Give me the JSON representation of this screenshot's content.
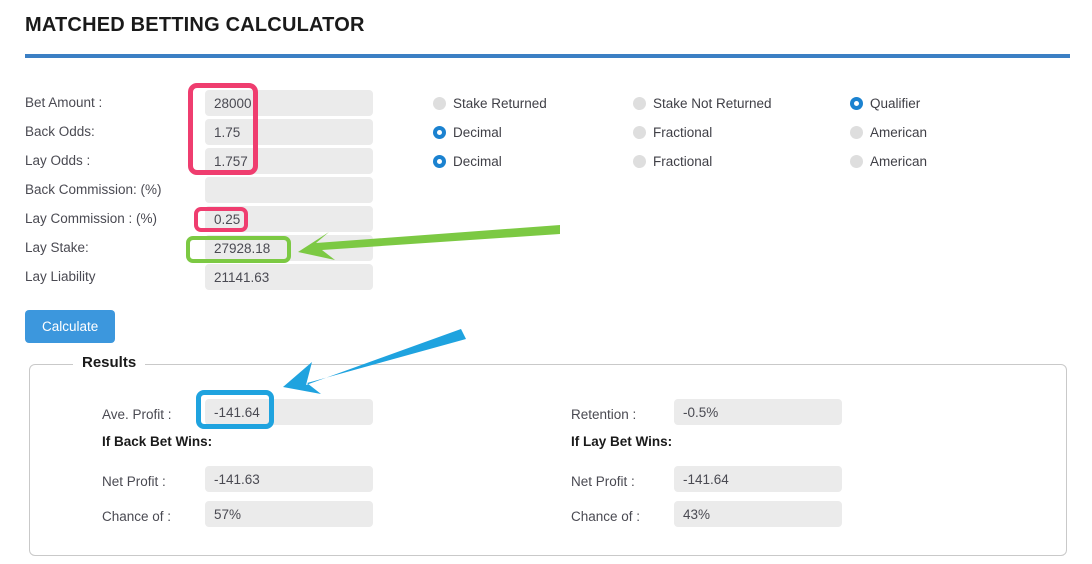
{
  "header": {
    "title": "MATCHED BETTING CALCULATOR"
  },
  "form": {
    "fields": [
      {
        "label": "Bet Amount :",
        "value": "28000",
        "name": "bet-amount"
      },
      {
        "label": "Back Odds:",
        "value": "1.75",
        "name": "back-odds"
      },
      {
        "label": "Lay Odds :",
        "value": "1.757",
        "name": "lay-odds"
      },
      {
        "label": "Back Commission: (%)",
        "value": "",
        "name": "back-commission"
      },
      {
        "label": "Lay Commission : (%)",
        "value": "0.25",
        "name": "lay-commission"
      },
      {
        "label": "Lay Stake:",
        "value": "27928.18",
        "name": "lay-stake"
      },
      {
        "label": "Lay Liability",
        "value": "21141.63",
        "name": "lay-liability"
      }
    ]
  },
  "options": {
    "rows": [
      {
        "name": "bet-type",
        "items": [
          {
            "label": "Stake Returned",
            "selected": false
          },
          {
            "label": "Stake Not Returned",
            "selected": false
          },
          {
            "label": "Qualifier",
            "selected": true
          }
        ]
      },
      {
        "name": "back-odds-format",
        "items": [
          {
            "label": "Decimal",
            "selected": true
          },
          {
            "label": "Fractional",
            "selected": false
          },
          {
            "label": "American",
            "selected": false
          }
        ]
      },
      {
        "name": "lay-odds-format",
        "items": [
          {
            "label": "Decimal",
            "selected": true
          },
          {
            "label": "Fractional",
            "selected": false
          },
          {
            "label": "American",
            "selected": false
          }
        ]
      }
    ]
  },
  "actions": {
    "calculate_label": "Calculate"
  },
  "results": {
    "legend": "Results",
    "left": {
      "summary_label": "Ave. Profit :",
      "summary_value": "-141.64",
      "subhead": "If Back Bet Wins:",
      "rows": [
        {
          "label": "Net Profit :",
          "value": "-141.63"
        },
        {
          "label": "Chance of :",
          "value": "57%"
        }
      ]
    },
    "right": {
      "summary_label": "Retention :",
      "summary_value": "-0.5%",
      "subhead": "If Lay Bet Wins:",
      "rows": [
        {
          "label": "Net Profit :",
          "value": "-141.64"
        },
        {
          "label": "Chance of :",
          "value": "43%"
        }
      ]
    }
  },
  "annotations": {
    "colors": {
      "pink": "#ef3d6f",
      "green": "#7cc943",
      "blue": "#1fa3df",
      "accent": "#3b7fc4"
    }
  }
}
